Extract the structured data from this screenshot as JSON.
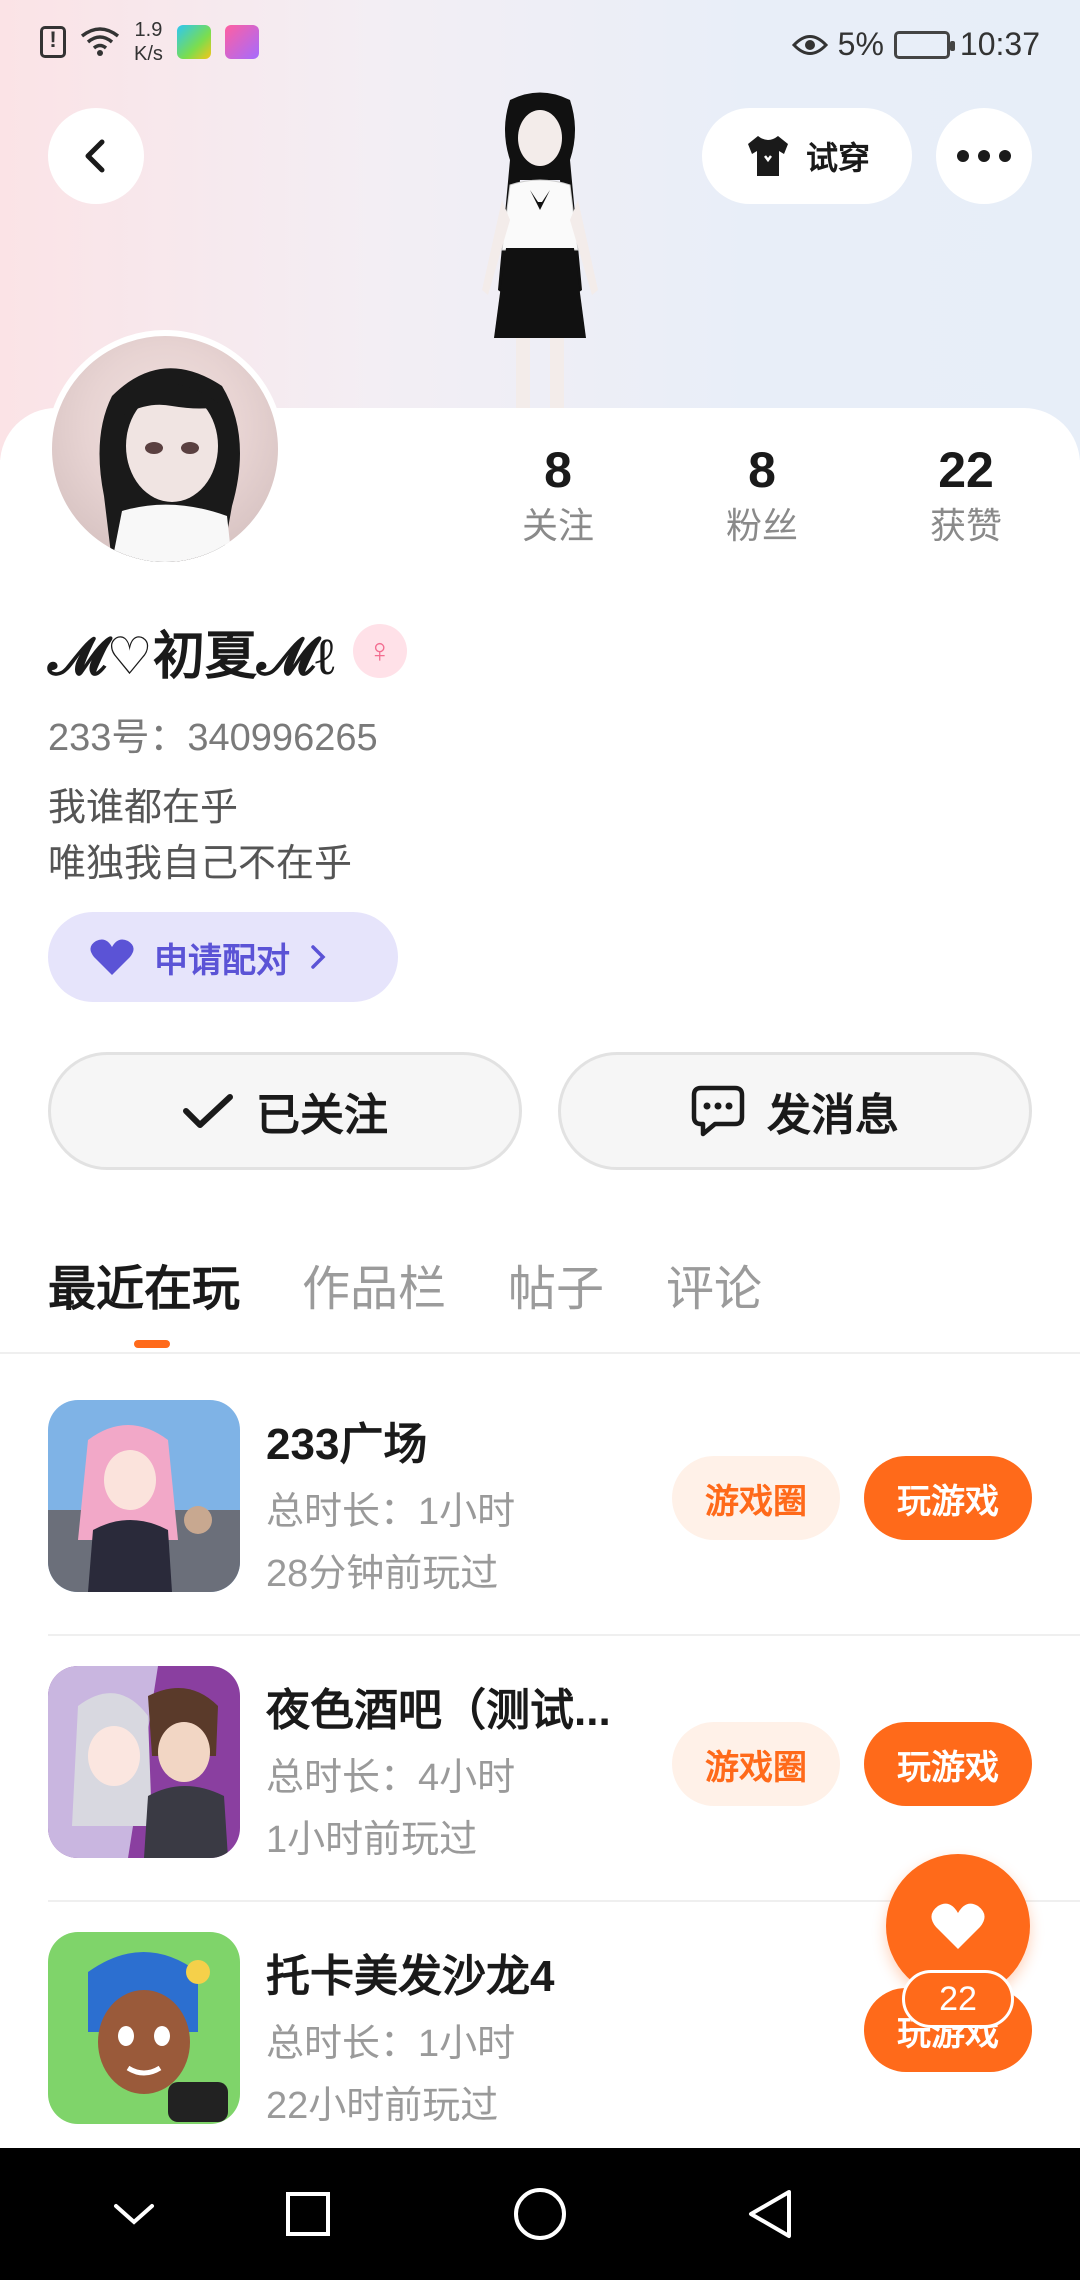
{
  "status_bar": {
    "speed_value": "1.9",
    "speed_unit": "K/s",
    "battery": "5%",
    "time": "10:37"
  },
  "header": {
    "try_on_label": "试穿"
  },
  "profile": {
    "nickname": "𝓜♡初夏𝓜ℓ",
    "gender_symbol": "♀",
    "user_id": "233号：340996265",
    "bio_line1": "我谁都在乎",
    "bio_line2": "唯独我自己不在乎",
    "pair_label": "申请配对"
  },
  "stats": [
    {
      "value": "8",
      "label": "关注"
    },
    {
      "value": "8",
      "label": "粉丝"
    },
    {
      "value": "22",
      "label": "获赞"
    }
  ],
  "actions": {
    "follow_label": "已关注",
    "message_label": "发消息"
  },
  "tabs": [
    "最近在玩",
    "作品栏",
    "帖子",
    "评论"
  ],
  "games": [
    {
      "name": "233广场",
      "duration": "总时长：1小时",
      "last_played": "28分钟前玩过",
      "circle_label": "游戏圈",
      "play_label": "玩游戏"
    },
    {
      "name": "夜色酒吧（测试...",
      "duration": "总时长：4小时",
      "last_played": "1小时前玩过",
      "circle_label": "游戏圈",
      "play_label": "玩游戏"
    },
    {
      "name": "托卡美发沙龙4",
      "duration": "总时长：1小时",
      "last_played": "22小时前玩过",
      "circle_label": "",
      "play_label": "玩游戏"
    }
  ],
  "like_fab": {
    "count": "22"
  },
  "colors": {
    "accent": "#ff6a1a",
    "accent_light": "#fff1e8",
    "pair_bg": "#e6e4fb",
    "pair_text": "#5b53d6"
  }
}
